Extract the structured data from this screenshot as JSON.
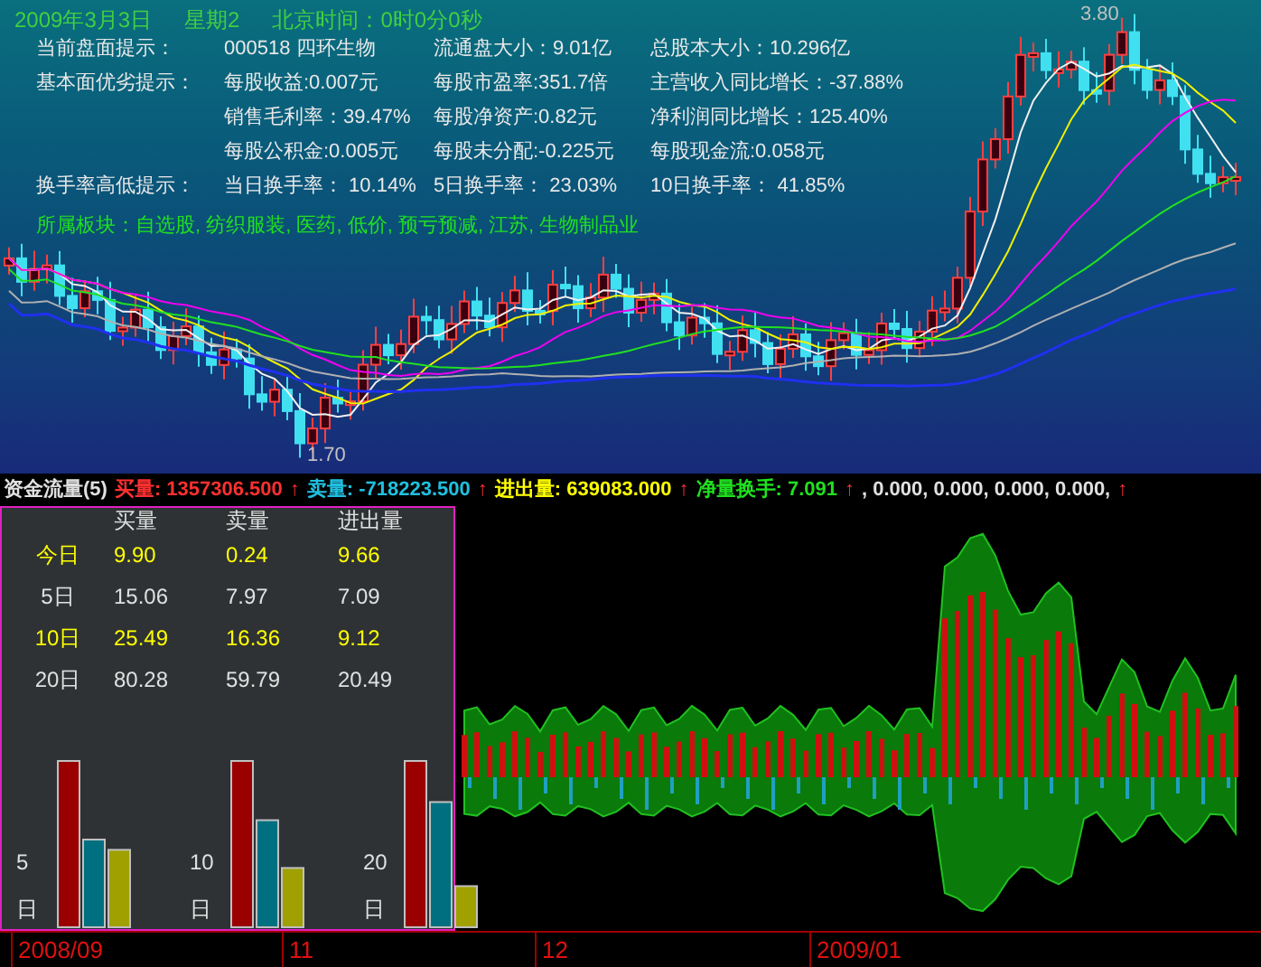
{
  "header": {
    "date": "2009年3月3日",
    "weekday": "星期2",
    "clock": "北京时间：0时0分0秒"
  },
  "info_rows": [
    {
      "label": "当前盘面提示：",
      "cells": [
        "000518 四环生物",
        "流通盘大小：9.01亿",
        "总股本大小：10.296亿"
      ]
    },
    {
      "label": "基本面优劣提示：",
      "cells": [
        "每股收益:0.007元",
        "每股市盈率:351.7倍",
        "主营收入同比增长：-37.88%"
      ]
    },
    {
      "cells": [
        "销售毛利率：39.47%",
        "每股净资产:0.82元",
        "净利润同比增长：125.40%"
      ]
    },
    {
      "cells": [
        "每股公积金:0.005元",
        "每股未分配:-0.225元",
        "每股现金流:0.058元"
      ]
    },
    {
      "label": "换手率高低提示：",
      "cells": [
        "当日换手率： 10.14%",
        "5日换手率： 23.03%",
        "10日换手率： 41.85%"
      ]
    }
  ],
  "sector": "所属板块：自选股, 纺织服装, 医药, 低价, 预亏预减, 江苏, 生物制品业",
  "price_labels": {
    "high": "3.80",
    "low": "1.70"
  },
  "indicator": [
    {
      "text": "资金流量(5)",
      "kind": "title"
    },
    {
      "text": "买量: 1357306.500",
      "kind": "buy"
    },
    {
      "text": "↑",
      "kind": "arrow"
    },
    {
      "text": "卖量: -718223.500",
      "kind": "sell"
    },
    {
      "text": "↑",
      "kind": "arrow"
    },
    {
      "text": "进出量: 639083.000",
      "kind": "net"
    },
    {
      "text": "↑",
      "kind": "arrow"
    },
    {
      "text": "净量换手: 7.091",
      "kind": "turnover"
    },
    {
      "text": "↑",
      "kind": "arrow"
    },
    {
      "text": ", 0.000, 0.000, 0.000, 0.000,",
      "kind": "title"
    },
    {
      "text": "↑",
      "kind": "arrow"
    }
  ],
  "table": {
    "columns": [
      "买量",
      "卖量",
      "进出量"
    ],
    "rows": [
      {
        "period": "今日",
        "values": [
          "9.90",
          "0.24",
          "9.66"
        ],
        "highlighted": true
      },
      {
        "period": "5日",
        "values": [
          "15.06",
          "7.97",
          "7.09"
        ],
        "highlighted": false
      },
      {
        "period": "10日",
        "values": [
          "25.49",
          "16.36",
          "9.12"
        ],
        "highlighted": true
      },
      {
        "period": "20日",
        "values": [
          "80.28",
          "59.79",
          "20.49"
        ],
        "highlighted": false
      }
    ]
  },
  "bar_groups": [
    {
      "number": "5",
      "unit": "日"
    },
    {
      "number": "10",
      "unit": "日"
    },
    {
      "number": "20",
      "unit": "日"
    }
  ],
  "x_axis": [
    "2008/09",
    "11",
    "12",
    "2009/01"
  ]
}
